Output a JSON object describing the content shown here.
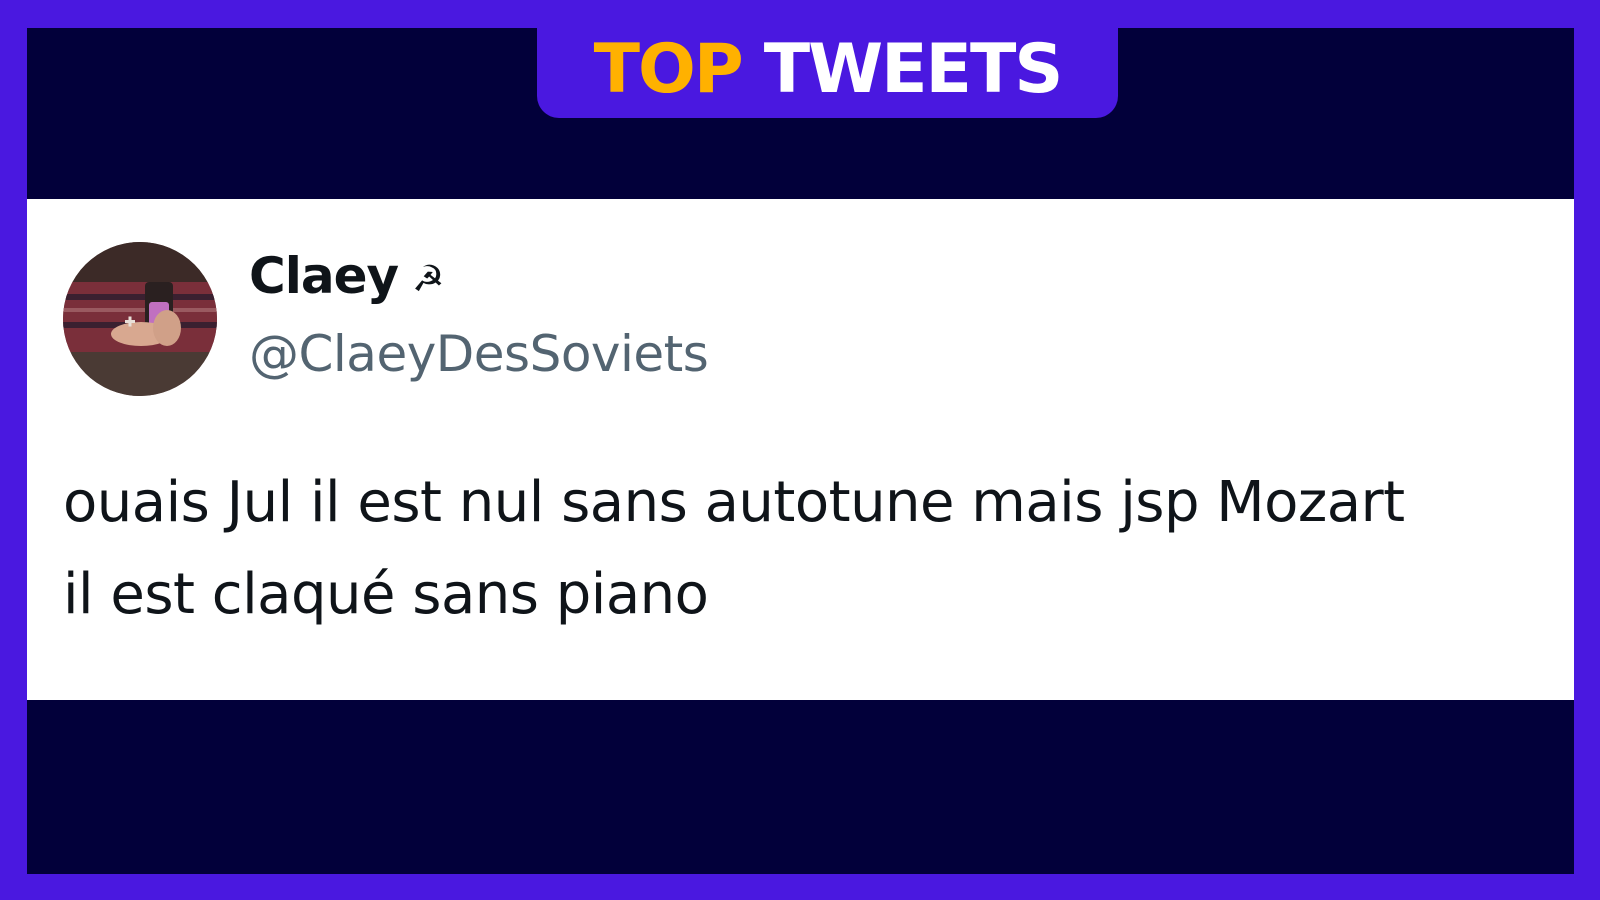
{
  "banner": {
    "word1": "TOP",
    "word2": "TWEETS",
    "word1_color": "#ffb100",
    "word2_color": "#ffffff",
    "background_color": "#4a18e0"
  },
  "tweet": {
    "display_name": "Claey",
    "name_emoji": "☭",
    "handle": "@ClaeyDesSoviets",
    "text_lines": [
      "ouais Jul il est nul sans autotune mais jsp Mozart",
      "il est claqué sans piano"
    ],
    "avatar_icon": "profile-photo"
  },
  "colors": {
    "border": "#4a18e0",
    "frame_background": "#02003a",
    "card_background": "#ffffff",
    "handle_color": "#536471"
  }
}
